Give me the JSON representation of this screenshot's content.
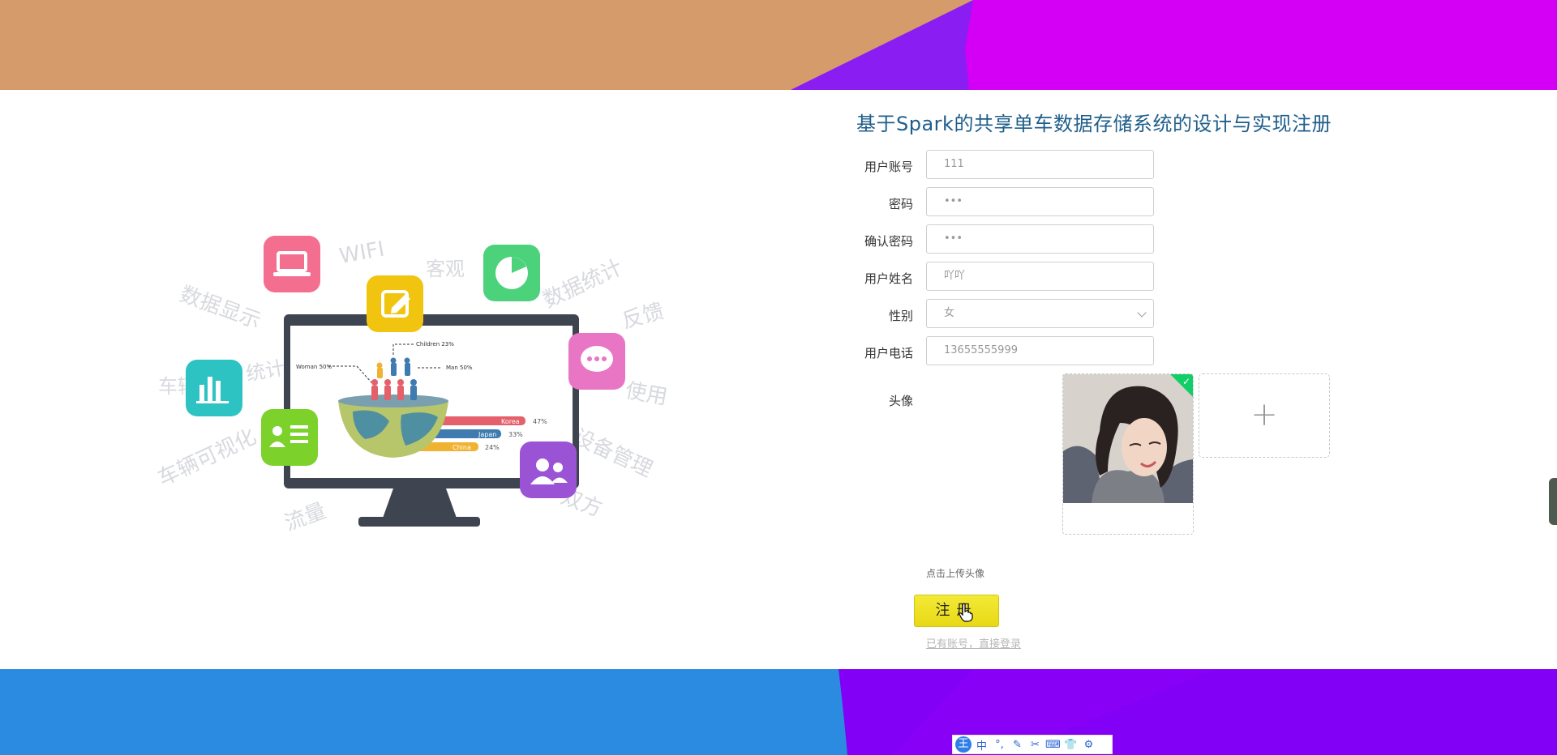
{
  "form": {
    "title": "基于Spark的共享单车数据存储系统的设计与实现注册",
    "fields": [
      {
        "label": "用户账号",
        "value": "111"
      },
      {
        "label": "密码",
        "value": "•••"
      },
      {
        "label": "确认密码",
        "value": "•••"
      },
      {
        "label": "用户姓名",
        "value": "吖吖"
      },
      {
        "label": "性别",
        "value": "女"
      },
      {
        "label": "用户电话",
        "value": "13655555999"
      }
    ],
    "avatar_label": "头像",
    "upload_hint": "点击上传头像",
    "register_button": "注册",
    "login_link": "已有账号，直接登录"
  },
  "illustration": {
    "words": [
      "WIFI",
      "客观",
      "数据统计",
      "数据显示",
      "反馈",
      "统计",
      "车辆",
      "使用",
      "车辆可视化",
      "设备管理",
      "流量",
      "双方"
    ],
    "chart_labels": {
      "children": "Children 23%",
      "woman": "Woman 50%",
      "man": "Man 50%",
      "korea": "Korea",
      "korea_pct": "47%",
      "japan": "Japan",
      "japan_pct": "33%",
      "china": "China",
      "china_pct": "24%"
    }
  },
  "ime": {
    "logo": "王",
    "items": [
      "中",
      "°,",
      "✎",
      "✂",
      "⌨",
      "👕",
      "⚙"
    ]
  },
  "colors": {
    "top_band_left": "#d59b6a",
    "top_band_right": "#d300f5",
    "bottom_band_left": "#2b8be0",
    "bottom_band_right": "#8100f5",
    "title_color": "#1f5e8a",
    "register_button": "#f0e424"
  }
}
